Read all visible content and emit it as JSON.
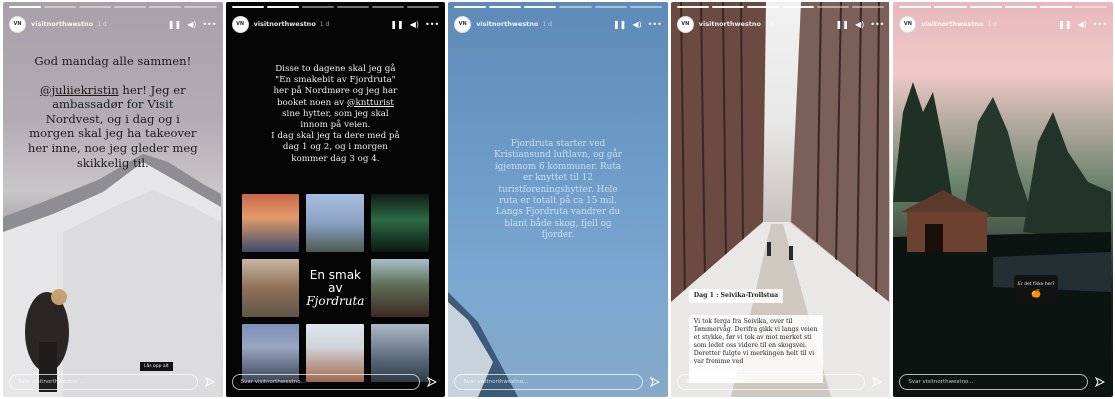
{
  "account": {
    "username": "visitnorthwestno",
    "age": "1 d",
    "reply_placeholder": "Svar visitnorthwestno..."
  },
  "icons": {
    "pause": "pause-icon",
    "volume": "volume-icon",
    "more": "more-options-icon",
    "send": "send-icon"
  },
  "stories": [
    {
      "text_lines": [
        "God mandag alle sammen!",
        "",
        "@juliiekristin her! Jeg er",
        "ambassadør for Visit",
        "Nordvest, og i dag og i",
        "morgen skal jeg ha takeover",
        "her inne, noe jeg gleder meg",
        "skikkelig til."
      ],
      "mention": "@juliiekristin",
      "tag": "Lås opp alt"
    },
    {
      "text_lines": [
        "Disse to dagene skal jeg gå",
        "\"En smakebit av Fjordruta\"",
        "her på Nordmøre og jeg har",
        "booket noen av @kntturist",
        "sine hytter, som jeg skal",
        "innom på veien.",
        "I dag skal jeg ta dere med på",
        "dag 1 og 2, og i morgen",
        "kommer dag 3 og 4."
      ],
      "mention": "@kntturist",
      "center_tile": {
        "line1": "En smak",
        "line2": "av",
        "line3": "Fjordruta"
      },
      "tile_colors": [
        "#d08b5b",
        "#8aa1c4",
        "#1f3a2c",
        "#a88e73",
        "#ffffff",
        "#5d6e55",
        "#6f85ad",
        "#cfd3da",
        "#5a6a7c"
      ]
    },
    {
      "text_lines": [
        "Fjordruta starter ved",
        "Kristiansund luftlavn, og går",
        "igjennom 6 kommuner. Ruta",
        "er knyttet til 12",
        "turistforeningshytter. Hele",
        "ruta er totalt på ca 15 mil.",
        "Langs Fjordruta vandrer du",
        "blant både skog, fjell og",
        "fjorder."
      ]
    },
    {
      "title": "Dag 1 : Seivika-Trollstua",
      "body": "Vi tok ferga fra Seivika, over til Tømmervåg. Derifra gikk vi langs veien et stykke, før vi tok av mot merket sti som ledet oss videre til en skogsvei. Deretter fulgte vi merkingen helt til vi var fremme ved"
    },
    {
      "sticker_question": "Er det fiske her?",
      "sticker_emoji": "🍊"
    }
  ]
}
